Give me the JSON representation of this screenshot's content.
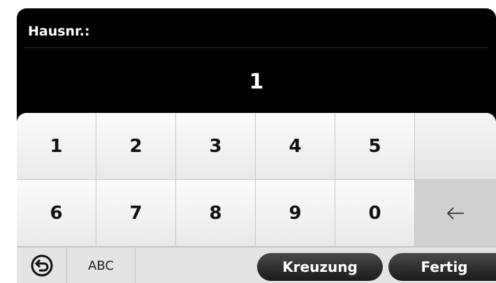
{
  "field": {
    "label": "Hausnr.:",
    "value": "1"
  },
  "keypad": {
    "row1": [
      "1",
      "2",
      "3",
      "4",
      "5",
      ""
    ],
    "row2": [
      "6",
      "7",
      "8",
      "9",
      "0"
    ]
  },
  "bottom": {
    "abc_label": "ABC",
    "crossing_label": "Kreuzung",
    "done_label": "Fertig"
  },
  "icons": {
    "back": "back-arrow-circle-icon",
    "backspace": "left-arrow-icon"
  }
}
